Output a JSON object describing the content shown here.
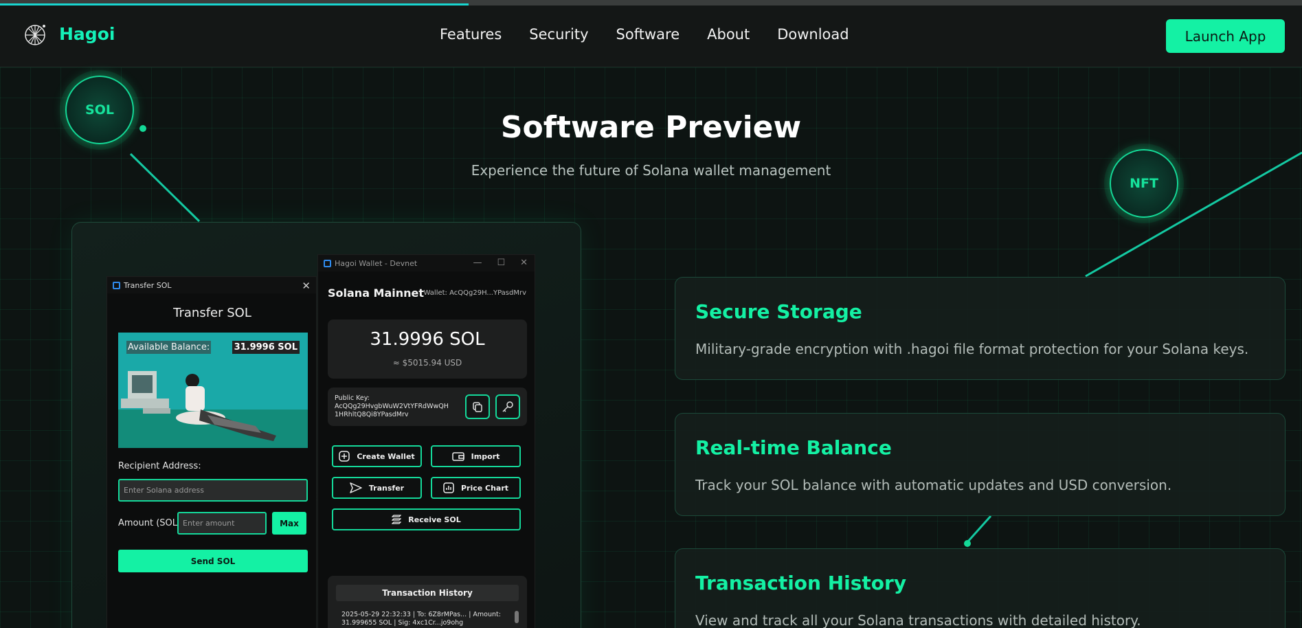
{
  "header": {
    "brand": "Hagoi",
    "nav": [
      "Features",
      "Security",
      "Software",
      "About",
      "Download"
    ],
    "launch_label": "Launch App",
    "scroll_progress_percent": 36
  },
  "hero": {
    "title": "Software Preview",
    "subtitle": "Experience the future of Solana wallet management"
  },
  "badges": {
    "sol": "SOL",
    "nft": "NFT"
  },
  "transfer_window": {
    "window_title": "Transfer SOL",
    "heading": "Transfer SOL",
    "balance_label": "Available Balance:",
    "balance_value": "31.9996 SOL",
    "recipient_label": "Recipient Address:",
    "recipient_placeholder": "Enter Solana address",
    "amount_label": "Amount (SOL):",
    "amount_placeholder": "Enter amount",
    "max_label": "Max",
    "send_label": "Send SOL"
  },
  "wallet_window": {
    "window_title": "Hagoi Wallet - Devnet",
    "network": "Solana Mainnet",
    "wallet_short": "Wallet: AcQQg29H...YPasdMrv",
    "balance": "31.9996 SOL",
    "usd": "≈ $5015.94 USD",
    "public_key_label": "Public Key:",
    "public_key": "AcQQg29HvgbWuW2VtYFRdWwQH1HRhltQ8Qi8YPasdMrv",
    "buttons": {
      "create_wallet": "Create Wallet",
      "import": "Import",
      "transfer": "Transfer",
      "price_chart": "Price Chart",
      "receive": "Receive SOL"
    },
    "history_title": "Transaction History",
    "history_entry": "2025-05-29 22:32:33 | To: 6Z8rMPas... | Amount: 31.999655 SOL | Sig: 4xc1Cr...jo9ohg"
  },
  "features": [
    {
      "title": "Secure Storage",
      "desc": "Military-grade encryption with .hagoi file format protection for your Solana keys."
    },
    {
      "title": "Real-time Balance",
      "desc": "Track your SOL balance with automatic updates and USD conversion."
    },
    {
      "title": "Transaction History",
      "desc": "View and track all your Solana transactions with detailed history."
    }
  ],
  "colors": {
    "accent": "#14f1a4",
    "background": "#0f1211",
    "window": "#0c0d0d"
  }
}
